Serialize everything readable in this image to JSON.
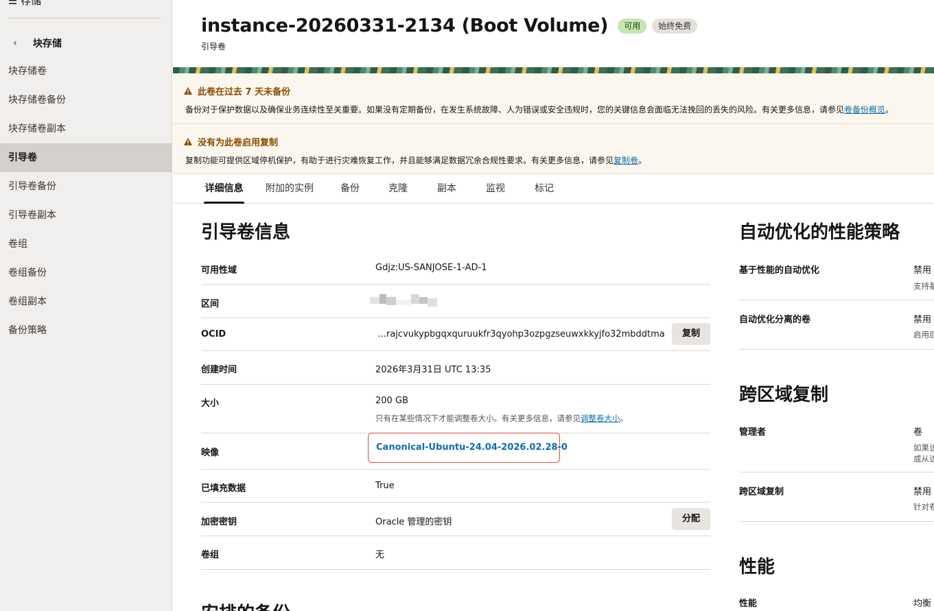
{
  "sidebar": {
    "top_label": "存储",
    "section_title": "块存储",
    "items": [
      {
        "label": "块存储卷"
      },
      {
        "label": "块存储卷备份"
      },
      {
        "label": "块存储卷副本"
      },
      {
        "label": "引导卷",
        "active": true
      },
      {
        "label": "引导卷备份"
      },
      {
        "label": "引导卷副本"
      },
      {
        "label": "卷组"
      },
      {
        "label": "卷组备份"
      },
      {
        "label": "卷组副本"
      },
      {
        "label": "备份策略"
      }
    ]
  },
  "header": {
    "title": "instance-20260331-2134 (Boot Volume)",
    "status_badge": "可用",
    "free_badge": "始终免费",
    "subtitle": "引导卷"
  },
  "alerts": [
    {
      "title": "此卷在过去 7 天未备份",
      "body": "备份对于保护数据以及确保业务连续性至关重要。如果没有定期备份，在发生系统故障、人为错误或安全违规时，您的关键信息会面临无法挽回的丢失的风险。有关更多信息，请参见",
      "link": "卷备份概览",
      "end": "。"
    },
    {
      "title": "没有为此卷启用复制",
      "body": "复制功能可提供区域停机保护，有助于进行灾难恢复工作，并且能够满足数据冗余合规性要求。有关更多信息，请参见",
      "link": "复制卷",
      "end": "。"
    }
  ],
  "tabs": [
    {
      "label": "详细信息",
      "active": true
    },
    {
      "label": "附加的实例"
    },
    {
      "label": "备份"
    },
    {
      "label": "克隆"
    },
    {
      "label": "副本"
    },
    {
      "label": "监视"
    },
    {
      "label": "标记"
    }
  ],
  "info": {
    "title": "引导卷信息",
    "availability_domain": {
      "label": "可用性域",
      "value": "Gdjz:US-SANJOSE-1-AD-1"
    },
    "compartment": {
      "label": "区间"
    },
    "ocid": {
      "label": "OCID",
      "value": "…rajcvukypbgqxquruukfr3qyohp3ozpgzseuwxkkyjfo32mbddtma",
      "button": "复制"
    },
    "created": {
      "label": "创建时间",
      "value": "2026年3月31日 UTC 13:35"
    },
    "size": {
      "label": "大小",
      "value": "200 GB",
      "hint": "只有在某些情况下才能调整卷大小。有关更多信息，请参见",
      "hint_link": "调整卷大小",
      "hint_end": "。"
    },
    "image": {
      "label": "映像",
      "value": "Canonical-Ubuntu-24.04-2026.02.28-0"
    },
    "hydrated": {
      "label": "已填充数据",
      "value": "True"
    },
    "encryption": {
      "label": "加密密钥",
      "value": "Oracle 管理的密钥",
      "button": "分配"
    },
    "volume_group": {
      "label": "卷组",
      "value": "无"
    },
    "next_title": "安排的备份"
  },
  "right": {
    "perf_policy_title": "自动优化的性能策略",
    "perf_auto": {
      "label": "基于性能的自动优化",
      "value": "禁用",
      "hint": "支持基"
    },
    "detached_auto": {
      "label": "自动优化分离的卷",
      "value": "禁用",
      "hint": "启用后"
    },
    "cross_region_title": "跨区域复制",
    "manager": {
      "label": "管理者",
      "value": "卷",
      "hint1": "如果该",
      "hint2": "或从该"
    },
    "cross_region": {
      "label": "跨区域复制",
      "value": "禁用",
      "hint": "针对卷"
    },
    "performance_title": "性能",
    "performance": {
      "label": "性能",
      "value": "均衡"
    }
  },
  "colors": {
    "link": "#0c6fa8",
    "warning": "#8a4b00",
    "status_green_bg": "#c6e5b4",
    "highlight_border": "#e04a3a"
  }
}
